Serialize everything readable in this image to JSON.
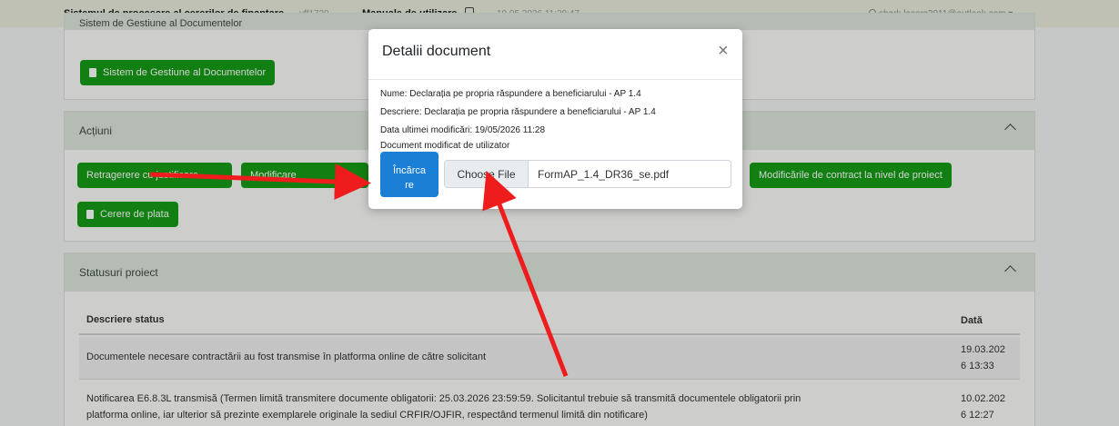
{
  "topbar": {
    "title": "Sistemul de procesare al cererilor de finanțare",
    "version": "vff1720...",
    "manual": "Manuale de utilizare",
    "datetime": "19.05.2026 11:29:47",
    "user": "shark.lasers2011@outlook.com"
  },
  "gestiune": {
    "header": "Sistem de Gestiune al Documentelor",
    "button": "Sistem de Gestiune al Documentelor"
  },
  "actiuni": {
    "header": "Acțiuni",
    "btn_retragere": "Retragerere cu justificare",
    "btn_modif": "Modificare",
    "btn_modif_contract": "Modificările de contract la nivel de proiect",
    "btn_cerere": "Cerere de plata"
  },
  "statusuri": {
    "header": "Statusuri proiect",
    "col_desc": "Descriere status",
    "col_date": "Dată",
    "rows": [
      {
        "desc": "Documentele necesare contractării au fost transmise în platforma online de către solicitant",
        "date_line1": "19.03.202",
        "date_line2": "6 13:33"
      },
      {
        "desc_line1": "Notificarea E6.8.3L transmisă (Termen limită transmitere documente obligatorii: 25.03.2026 23:59:59. Solicitantul trebuie să transmită documentele obligatorii prin",
        "desc_line2": "platforma online, iar ulterior să prezinte exemplarele originale la sediul CRFIR/OJFIR, respectând termenul limită din notificare)",
        "date_line1": "10.02.202",
        "date_line2": "6 12:27"
      }
    ]
  },
  "modal": {
    "title": "Detalii document",
    "close": "×",
    "nume": "Nume: Declarația pe propria răspundere a beneficiarului - AP 1.4",
    "descriere": "Descriere: Declarația pe propria răspundere a beneficiarului - AP 1.4",
    "data": "Data ultimei modificări: 19/05/2026 11:28",
    "modificat": "Document modificat de utilizator",
    "upload_line1": "Încărca",
    "upload_line2": "re",
    "choose_file": "Choose File",
    "file_name": "FormAP_1.4_DR36_se.pdf"
  },
  "colors": {
    "green": "#169c16",
    "blue": "#1b7fd6",
    "arrow": "#ee1c1c"
  }
}
